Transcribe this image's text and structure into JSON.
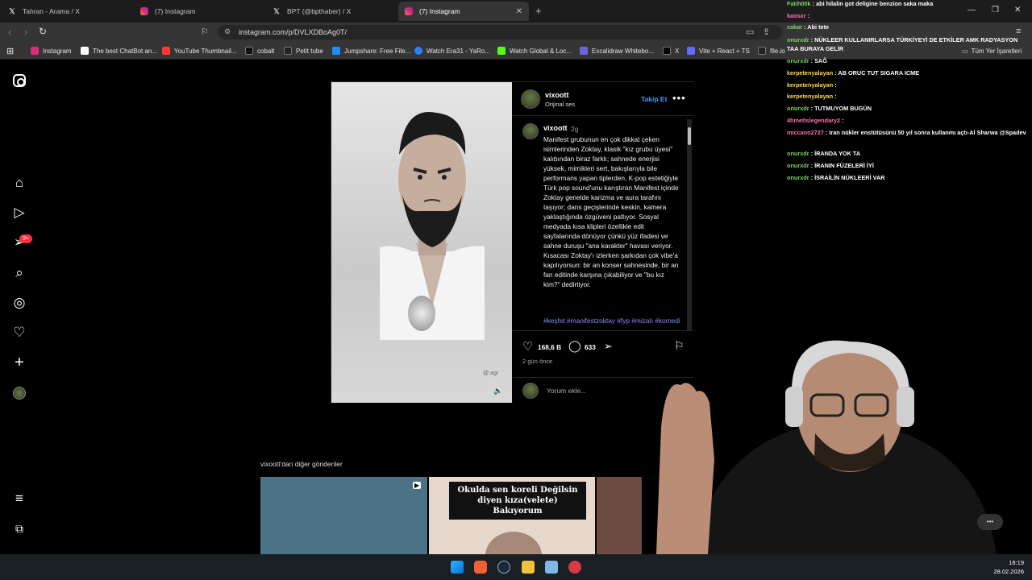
{
  "browser": {
    "tabs": [
      {
        "title": "Tahran - Arama / X",
        "icon": "x-logo-icon"
      },
      {
        "title": "(7) Instagram",
        "icon": "instagram-icon"
      },
      {
        "title": "BPT (@bpthaber) / X",
        "icon": "x-logo-icon"
      },
      {
        "title": "(7) Instagram",
        "icon": "instagram-icon",
        "active": true
      }
    ],
    "url": "instagram.com/p/DVLXDBoAg0T/",
    "bookmarks": [
      {
        "label": "Instagram",
        "color": "#dd2a7b"
      },
      {
        "label": "The best ChatBot an...",
        "color": "#ffffff"
      },
      {
        "label": "YouTube Thumbnail...",
        "color": "#ff3b30"
      },
      {
        "label": "cobalt",
        "color": "#111111"
      },
      {
        "label": "Petit tube",
        "color": "#222222"
      },
      {
        "label": "Jumpshare: Free File...",
        "color": "#1f8fff"
      },
      {
        "label": "Watch Era31 - YaRo...",
        "color": "#2d7ff9"
      },
      {
        "label": "Watch Global & Loc...",
        "color": "#53fc18"
      },
      {
        "label": "Excalidraw Whitebo...",
        "color": "#6965db"
      },
      {
        "label": "X",
        "color": "#000000"
      },
      {
        "label": "Vite + React + TS",
        "color": "#646cff"
      },
      {
        "label": "file.io",
        "color": "#222222"
      }
    ],
    "all_bookmarks": "Tüm Yer İşaretleri"
  },
  "post": {
    "username": "vixoott",
    "audio": "Orijinal ses",
    "follow_label": "Takip Et",
    "time_ago_short": "2g",
    "caption": "Manifest grubunun en çok dikkat çeken isimlerinden Zoktay, klasik \"kız grubu üyesi\" kalıbından biraz farklı; sahnede enerjisi yüksek, mimikleri sert, bakışlarıyla bile performans yapan tiplerden. K-pop estetiğiyle Türk pop sound'unu karıştıran Manifest içinde Zoktay genelde karizma ve aura tarafını taşıyor; dans geçişlerinde keskin, kamera yaklaştığında özgüveni patlıyor. Sosyal medyada kısa klipleri özellikle edit sayfalarında dönüyor çünkü yüz ifadesi ve sahne duruşu \"ana karakter\" havası veriyor. Kısacası Zoktay'ı izlerken şarkıdan çok vibe'a kapılıyorsun: bir an konser sahnesinde, bir an fan editinde karşına çıkabiliyor ve \"bu kız kim?\" dedirtiyor.",
    "tags": "#keşfet #manifestzoktay #fyp #mizah #komedi",
    "likes": "168,6 B",
    "comments": "633",
    "posted": "2 gün önce",
    "comment_placeholder": "Yorum ekle...",
    "watermark": "@ agr",
    "more_from": "vixoott'dan diğer gönderiler",
    "grid_text": "Okulda sen koreli Değilsin diyen kıza(velete) Bakıyorum"
  },
  "sidebar": {
    "notification_badge": "9+",
    "items": [
      "home-icon",
      "reels-icon",
      "messages-icon",
      "search-icon",
      "explore-icon",
      "heart-icon",
      "create-icon",
      "profile-icon",
      "menu-icon",
      "more-icon"
    ]
  },
  "chat": [
    {
      "user": "Fatih00k",
      "msg": ": abi hilalin got deligine benzion saka maka"
    },
    {
      "user": "kaosxr",
      "msg": ":"
    },
    {
      "user": "cakar",
      "msg": ": Abi tete"
    },
    {
      "user": "onurxdr",
      "msg": ": NÜKLEER KULLANIRLARSA TÜRKİYEYİ DE ETKİLER AMK RADYASYON TAA BURAYA GELİR"
    },
    {
      "user": "onurxdr",
      "msg": ": SAĞ"
    },
    {
      "user": "kerpetenyalayan",
      "msg": ": AB ORUC TUT SIGARA ICME"
    },
    {
      "user": "kerpetenyalayan",
      "msg": ":"
    },
    {
      "user": "kerpetenyalayan",
      "msg": ":"
    },
    {
      "user": "onurxdr",
      "msg": ": TUTMUYOM BUGÜN"
    },
    {
      "user": "4hmetIslegendary2",
      "msg": ":"
    },
    {
      "user": "miccano2727",
      "msg": ": Iran nükler enstütüsünü 50 yıl sonra kullanmı açtı-Al Sharwa @Spadev"
    },
    {
      "user": "onurxdr",
      "msg": ": İRANDA YOK TA"
    },
    {
      "user": "onurxdr",
      "msg": ": İRANIN FÜZELERİ İYİ"
    },
    {
      "user": "onurxdr",
      "msg": ": İSRAİLİN NÜKLEERİ VAR"
    }
  ],
  "taskbar": {
    "time": "18:19",
    "date": "28.02.2026"
  }
}
